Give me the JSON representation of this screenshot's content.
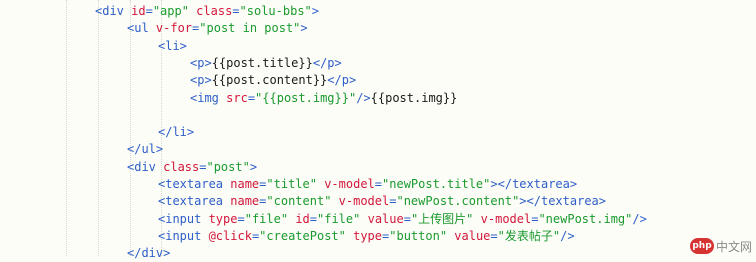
{
  "code_lines": [
    {
      "indent": 95,
      "tokens": [
        {
          "t": "tag",
          "v": "<div "
        },
        {
          "t": "attr",
          "v": "id"
        },
        {
          "t": "tag",
          "v": "="
        },
        {
          "t": "str",
          "v": "\"app\""
        },
        {
          "t": "tag",
          "v": " "
        },
        {
          "t": "attr",
          "v": "class"
        },
        {
          "t": "tag",
          "v": "="
        },
        {
          "t": "str",
          "v": "\"solu-bbs\""
        },
        {
          "t": "tag",
          "v": ">"
        }
      ]
    },
    {
      "indent": 127,
      "tokens": [
        {
          "t": "tag",
          "v": "<ul "
        },
        {
          "t": "attr",
          "v": "v-for"
        },
        {
          "t": "tag",
          "v": "="
        },
        {
          "t": "str",
          "v": "\"post in post\""
        },
        {
          "t": "tag",
          "v": ">"
        }
      ]
    },
    {
      "indent": 158,
      "tokens": [
        {
          "t": "tag",
          "v": "<li>"
        }
      ]
    },
    {
      "indent": 190,
      "tokens": [
        {
          "t": "tag",
          "v": "<p>"
        },
        {
          "t": "txt",
          "v": "{{post.title}}"
        },
        {
          "t": "tag",
          "v": "</p>"
        }
      ]
    },
    {
      "indent": 190,
      "tokens": [
        {
          "t": "tag",
          "v": "<p>"
        },
        {
          "t": "txt",
          "v": "{{post.content}}"
        },
        {
          "t": "tag",
          "v": "</p>"
        }
      ]
    },
    {
      "indent": 190,
      "tokens": [
        {
          "t": "tag",
          "v": "<img "
        },
        {
          "t": "attr",
          "v": "src"
        },
        {
          "t": "tag",
          "v": "="
        },
        {
          "t": "str",
          "v": "\"{{post.img}}\""
        },
        {
          "t": "tag",
          "v": "/>"
        },
        {
          "t": "txt",
          "v": "{{post.img}}"
        }
      ]
    },
    {
      "indent": 190,
      "tokens": []
    },
    {
      "indent": 158,
      "tokens": [
        {
          "t": "tag",
          "v": "</li>"
        }
      ]
    },
    {
      "indent": 127,
      "tokens": [
        {
          "t": "tag",
          "v": "</ul>"
        }
      ]
    },
    {
      "indent": 127,
      "tokens": [
        {
          "t": "tag",
          "v": "<div "
        },
        {
          "t": "attr",
          "v": "class"
        },
        {
          "t": "tag",
          "v": "="
        },
        {
          "t": "str",
          "v": "\"post\""
        },
        {
          "t": "tag",
          "v": ">"
        }
      ]
    },
    {
      "indent": 158,
      "tokens": [
        {
          "t": "tag",
          "v": "<textarea "
        },
        {
          "t": "attr",
          "v": "name"
        },
        {
          "t": "tag",
          "v": "="
        },
        {
          "t": "str",
          "v": "\"title\""
        },
        {
          "t": "tag",
          "v": " "
        },
        {
          "t": "attr",
          "v": "v-model"
        },
        {
          "t": "tag",
          "v": "="
        },
        {
          "t": "str",
          "v": "\"newPost.title\""
        },
        {
          "t": "tag",
          "v": "></textarea>"
        }
      ]
    },
    {
      "indent": 158,
      "tokens": [
        {
          "t": "tag",
          "v": "<textarea "
        },
        {
          "t": "attr",
          "v": "name"
        },
        {
          "t": "tag",
          "v": "="
        },
        {
          "t": "str",
          "v": "\"content\""
        },
        {
          "t": "tag",
          "v": " "
        },
        {
          "t": "attr",
          "v": "v-model"
        },
        {
          "t": "tag",
          "v": "="
        },
        {
          "t": "str",
          "v": "\"newPost.content\""
        },
        {
          "t": "tag",
          "v": "></textarea>"
        }
      ]
    },
    {
      "indent": 158,
      "tokens": [
        {
          "t": "tag",
          "v": "<input "
        },
        {
          "t": "attr",
          "v": "type"
        },
        {
          "t": "tag",
          "v": "="
        },
        {
          "t": "str",
          "v": "\"file\""
        },
        {
          "t": "tag",
          "v": " "
        },
        {
          "t": "attr",
          "v": "id"
        },
        {
          "t": "tag",
          "v": "="
        },
        {
          "t": "str",
          "v": "\"file\""
        },
        {
          "t": "tag",
          "v": " "
        },
        {
          "t": "attr",
          "v": "value"
        },
        {
          "t": "tag",
          "v": "="
        },
        {
          "t": "str",
          "v": "\"上传图片\""
        },
        {
          "t": "tag",
          "v": " "
        },
        {
          "t": "attr",
          "v": "v-model"
        },
        {
          "t": "tag",
          "v": "="
        },
        {
          "t": "str",
          "v": "\"newPost.img\""
        },
        {
          "t": "tag",
          "v": "/>"
        }
      ]
    },
    {
      "indent": 158,
      "tokens": [
        {
          "t": "tag",
          "v": "<input "
        },
        {
          "t": "attr",
          "v": "@click"
        },
        {
          "t": "tag",
          "v": "="
        },
        {
          "t": "str",
          "v": "\"createPost\""
        },
        {
          "t": "tag",
          "v": " "
        },
        {
          "t": "attr",
          "v": "type"
        },
        {
          "t": "tag",
          "v": "="
        },
        {
          "t": "str",
          "v": "\"button\""
        },
        {
          "t": "tag",
          "v": " "
        },
        {
          "t": "attr",
          "v": "value"
        },
        {
          "t": "tag",
          "v": "="
        },
        {
          "t": "str",
          "v": "\"发表帖子\""
        },
        {
          "t": "tag",
          "v": "/>"
        }
      ]
    },
    {
      "indent": 127,
      "tokens": [
        {
          "t": "tag",
          "v": "</div>"
        }
      ]
    }
  ],
  "colors": {
    "background": "#fdfdf8",
    "tag": "#2d5ec8",
    "attribute": "#d2173a",
    "string": "#1a9a2e",
    "text": "#1a1a1a"
  },
  "watermark": {
    "logo": "php",
    "label": "中文网"
  }
}
